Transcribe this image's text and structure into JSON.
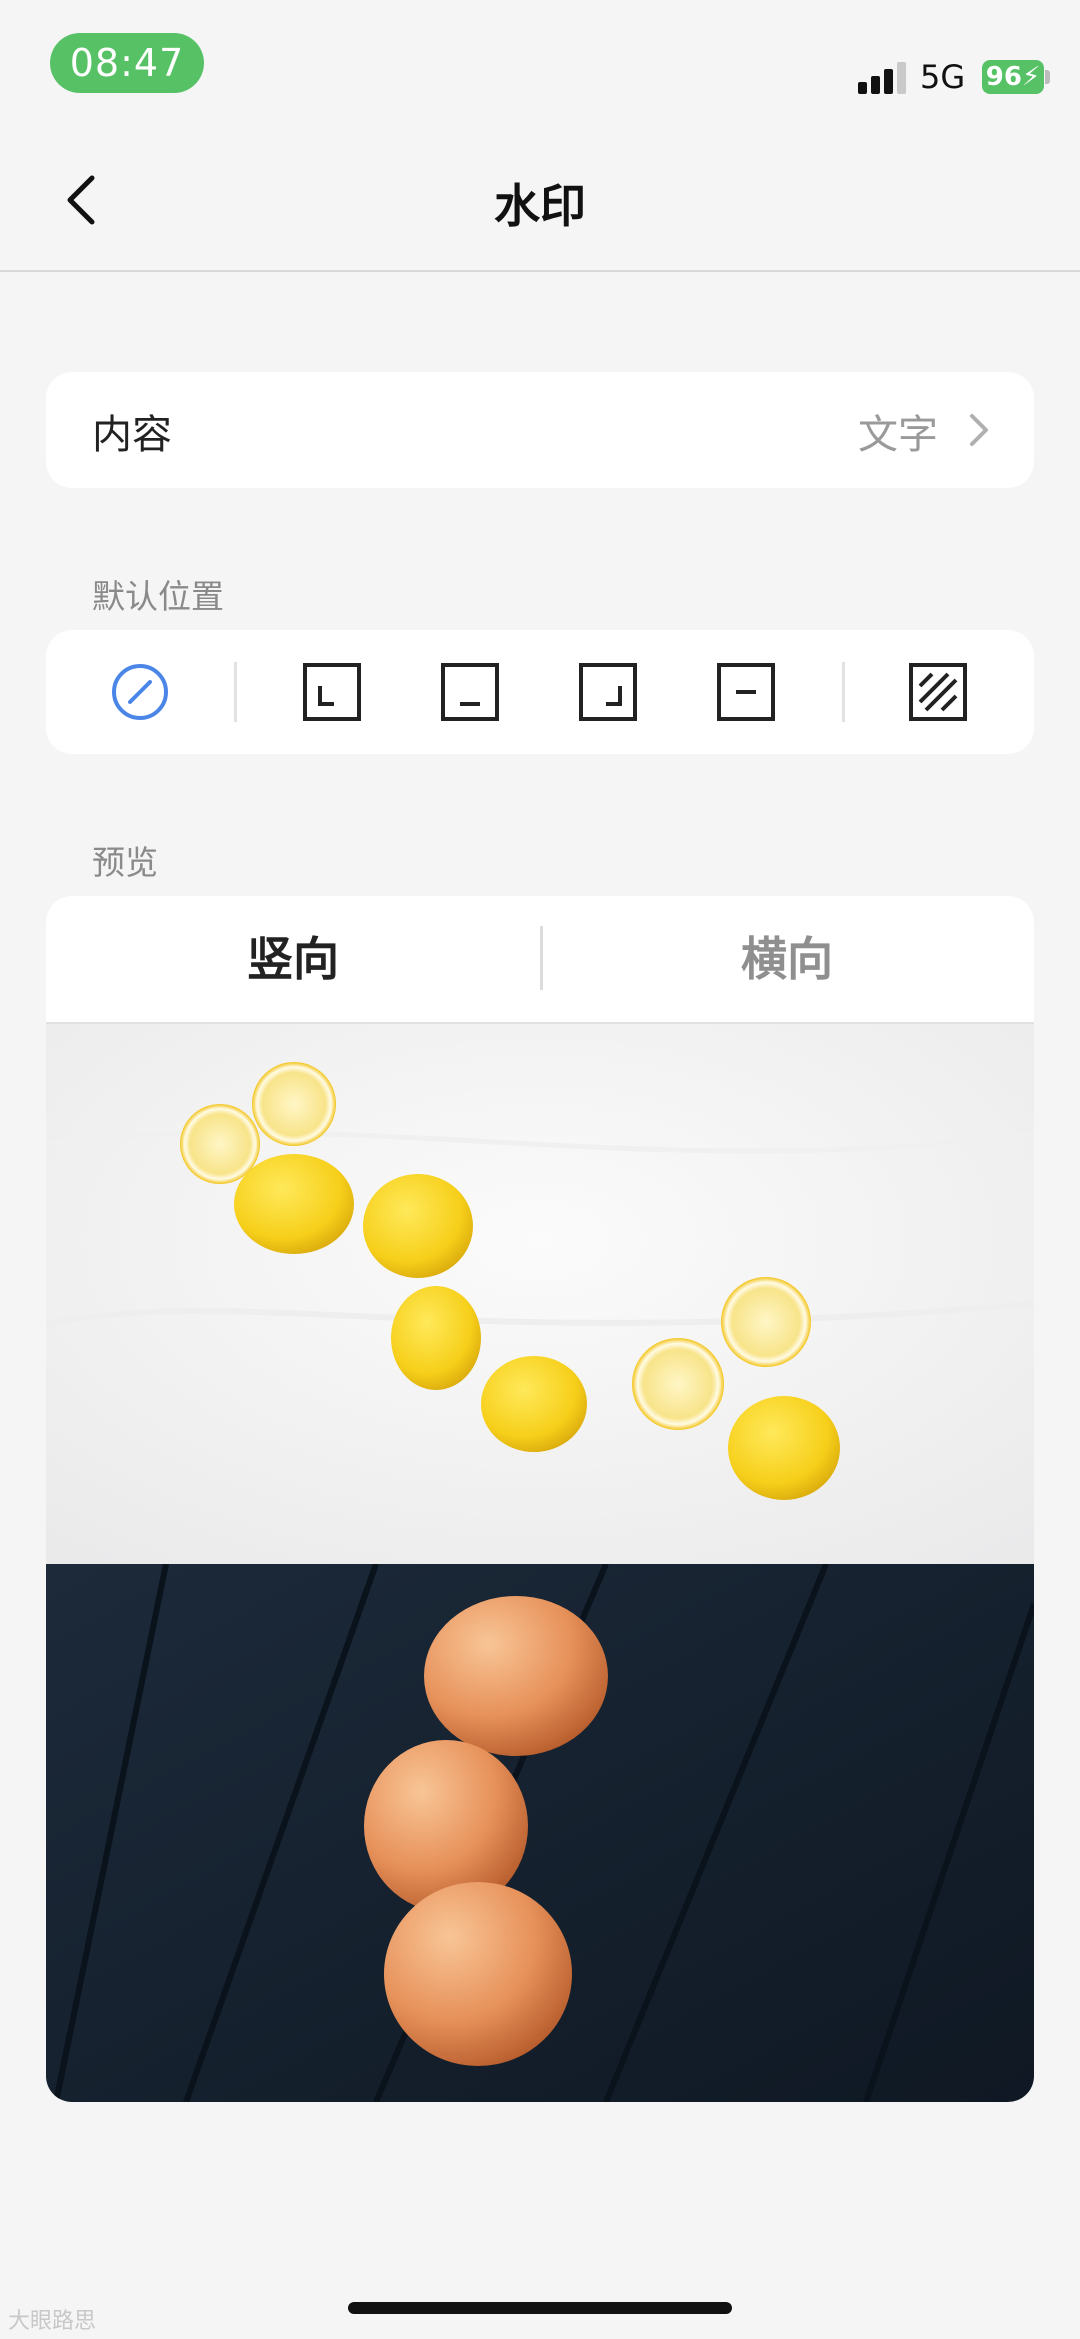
{
  "status_bar": {
    "time": "08:47",
    "network": "5G",
    "battery": "96",
    "accent": "#57c265"
  },
  "nav": {
    "title": "水印",
    "back_icon": "chevron-left-icon"
  },
  "content_row": {
    "label": "内容",
    "value": "文字",
    "icon": "chevron-right-icon"
  },
  "default_position": {
    "label": "默认位置",
    "options": [
      "none",
      "bottom-left",
      "bottom-center",
      "bottom-right",
      "center",
      "tiled"
    ],
    "selected": "none",
    "selected_color": "#4a86e8"
  },
  "preview": {
    "label": "预览",
    "tabs": [
      "竖向",
      "横向"
    ],
    "selected_tab": "竖向",
    "images": [
      "lemons-photo",
      "apricots-photo"
    ]
  },
  "footer": {
    "brand": "大眼路思"
  }
}
